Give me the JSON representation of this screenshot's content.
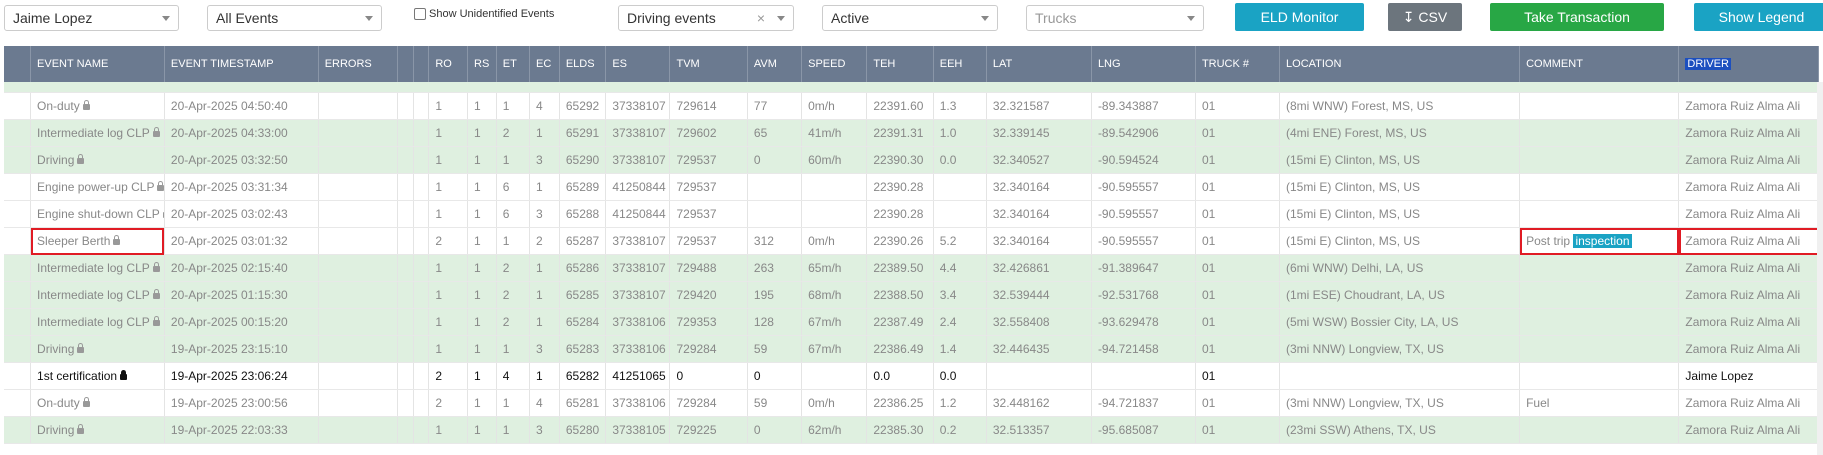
{
  "toolbar": {
    "driver": "Jaime Lopez",
    "events_filter": "All Events",
    "show_unidentified": "Show Unidentified Events",
    "event_type": "Driving events",
    "clear_glyph": "×",
    "status": "Active",
    "trucks_placeholder": "Trucks",
    "eld_monitor": "ELD Monitor",
    "csv": "CSV",
    "take_transaction": "Take Transaction",
    "show_legend": "Show Legend"
  },
  "columns": [
    "",
    "EVENT NAME",
    "EVENT TIMESTAMP",
    "ERRORS",
    "",
    "",
    "RO",
    "RS",
    "ET",
    "EC",
    "ELDS",
    "ES",
    "TVM",
    "AVM",
    "SPEED",
    "TEH",
    "EEH",
    "LAT",
    "LNG",
    "TRUCK #",
    "LOCATION",
    "COMMENT",
    "DRIVER"
  ],
  "rows": [
    {
      "style": "w",
      "name": "On-duty",
      "ts": "20-Apr-2025 04:50:40",
      "ro": "1",
      "rs": "1",
      "et": "1",
      "ec": "4",
      "elds": "65292",
      "es": "37338107",
      "tvm": "729614",
      "avm": "77",
      "speed": "0m/h",
      "teh": "22391.60",
      "eeh": "1.3",
      "lat": "32.321587",
      "lng": "-89.343887",
      "truck": "01",
      "loc": "(8mi WNW) Forest, MS, US",
      "comment": "",
      "driver": "Zamora Ruiz Alma Ali"
    },
    {
      "style": "g",
      "name": "Intermediate log CLP",
      "ts": "20-Apr-2025 04:33:00",
      "ro": "1",
      "rs": "1",
      "et": "2",
      "ec": "1",
      "elds": "65291",
      "es": "37338107",
      "tvm": "729602",
      "avm": "65",
      "speed": "41m/h",
      "teh": "22391.31",
      "eeh": "1.0",
      "lat": "32.339145",
      "lng": "-89.542906",
      "truck": "01",
      "loc": "(4mi ENE) Forest, MS, US",
      "comment": "",
      "driver": "Zamora Ruiz Alma Ali"
    },
    {
      "style": "g",
      "name": "Driving",
      "ts": "20-Apr-2025 03:32:50",
      "ro": "1",
      "rs": "1",
      "et": "1",
      "ec": "3",
      "elds": "65290",
      "es": "37338107",
      "tvm": "729537",
      "avm": "0",
      "speed": "60m/h",
      "teh": "22390.30",
      "eeh": "0.0",
      "lat": "32.340527",
      "lng": "-90.594524",
      "truck": "01",
      "loc": "(15mi E) Clinton, MS, US",
      "comment": "",
      "driver": "Zamora Ruiz Alma Ali"
    },
    {
      "style": "w",
      "name": "Engine power-up CLP",
      "ts": "20-Apr-2025 03:31:34",
      "ro": "1",
      "rs": "1",
      "et": "6",
      "ec": "1",
      "elds": "65289",
      "es": "41250844",
      "tvm": "729537",
      "avm": "",
      "speed": "",
      "teh": "22390.28",
      "eeh": "",
      "lat": "32.340164",
      "lng": "-90.595557",
      "truck": "01",
      "loc": "(15mi E) Clinton, MS, US",
      "comment": "",
      "driver": "Zamora Ruiz Alma Ali"
    },
    {
      "style": "w",
      "name": "Engine shut-down CLP",
      "ts": "20-Apr-2025 03:02:43",
      "ro": "1",
      "rs": "1",
      "et": "6",
      "ec": "3",
      "elds": "65288",
      "es": "41250844",
      "tvm": "729537",
      "avm": "",
      "speed": "",
      "teh": "22390.28",
      "eeh": "",
      "lat": "32.340164",
      "lng": "-90.595557",
      "truck": "01",
      "loc": "(15mi E) Clinton, MS, US",
      "comment": "",
      "driver": "Zamora Ruiz Alma Ali"
    },
    {
      "style": "w",
      "name": "Sleeper Berth",
      "ts": "20-Apr-2025 03:01:32",
      "ro": "2",
      "rs": "1",
      "et": "1",
      "ec": "2",
      "elds": "65287",
      "es": "37338107",
      "tvm": "729537",
      "avm": "312",
      "speed": "0m/h",
      "teh": "22390.26",
      "eeh": "5.2",
      "lat": "32.340164",
      "lng": "-90.595557",
      "truck": "01",
      "loc": "(15mi E) Clinton, MS, US",
      "comment": "Post trip",
      "comment_hl": "inspection",
      "driver": "Zamora Ruiz Alma Ali",
      "hl": true
    },
    {
      "style": "g",
      "name": "Intermediate log CLP",
      "ts": "20-Apr-2025 02:15:40",
      "ro": "1",
      "rs": "1",
      "et": "2",
      "ec": "1",
      "elds": "65286",
      "es": "37338107",
      "tvm": "729488",
      "avm": "263",
      "speed": "65m/h",
      "teh": "22389.50",
      "eeh": "4.4",
      "lat": "32.426861",
      "lng": "-91.389647",
      "truck": "01",
      "loc": "(6mi WNW) Delhi, LA, US",
      "comment": "",
      "driver": "Zamora Ruiz Alma Ali"
    },
    {
      "style": "g",
      "name": "Intermediate log CLP",
      "ts": "20-Apr-2025 01:15:30",
      "ro": "1",
      "rs": "1",
      "et": "2",
      "ec": "1",
      "elds": "65285",
      "es": "37338107",
      "tvm": "729420",
      "avm": "195",
      "speed": "68m/h",
      "teh": "22388.50",
      "eeh": "3.4",
      "lat": "32.539444",
      "lng": "-92.531768",
      "truck": "01",
      "loc": "(1mi ESE) Choudrant, LA, US",
      "comment": "",
      "driver": "Zamora Ruiz Alma Ali"
    },
    {
      "style": "g",
      "name": "Intermediate log CLP",
      "ts": "20-Apr-2025 00:15:20",
      "ro": "1",
      "rs": "1",
      "et": "2",
      "ec": "1",
      "elds": "65284",
      "es": "37338106",
      "tvm": "729353",
      "avm": "128",
      "speed": "67m/h",
      "teh": "22387.49",
      "eeh": "2.4",
      "lat": "32.558408",
      "lng": "-93.629478",
      "truck": "01",
      "loc": "(5mi WSW) Bossier City, LA, US",
      "comment": "",
      "driver": "Zamora Ruiz Alma Ali"
    },
    {
      "style": "g",
      "name": "Driving",
      "ts": "19-Apr-2025 23:15:10",
      "ro": "1",
      "rs": "1",
      "et": "1",
      "ec": "3",
      "elds": "65283",
      "es": "37338106",
      "tvm": "729284",
      "avm": "59",
      "speed": "67m/h",
      "teh": "22386.49",
      "eeh": "1.4",
      "lat": "32.446435",
      "lng": "-94.721458",
      "truck": "01",
      "loc": "(3mi NNW) Longview, TX, US",
      "comment": "",
      "driver": "Zamora Ruiz Alma Ali"
    },
    {
      "style": "w cert",
      "name": "1st certification",
      "ts": "19-Apr-2025 23:06:24",
      "ro": "2",
      "rs": "1",
      "et": "4",
      "ec": "1",
      "elds": "65282",
      "es": "41251065",
      "tvm": "0",
      "avm": "0",
      "speed": "",
      "teh": "0.0",
      "eeh": "0.0",
      "lat": "",
      "lng": "",
      "truck": "01",
      "loc": "",
      "comment": "",
      "driver": "Jaime Lopez"
    },
    {
      "style": "w",
      "name": "On-duty",
      "ts": "19-Apr-2025 23:00:56",
      "ro": "2",
      "rs": "1",
      "et": "1",
      "ec": "4",
      "elds": "65281",
      "es": "37338106",
      "tvm": "729284",
      "avm": "59",
      "speed": "0m/h",
      "teh": "22386.25",
      "eeh": "1.2",
      "lat": "32.448162",
      "lng": "-94.721837",
      "truck": "01",
      "loc": "(3mi NNW) Longview, TX, US",
      "comment": "Fuel",
      "driver": "Zamora Ruiz Alma Ali"
    },
    {
      "style": "g",
      "name": "Driving",
      "ts": "19-Apr-2025 22:03:33",
      "ro": "1",
      "rs": "1",
      "et": "1",
      "ec": "3",
      "elds": "65280",
      "es": "37338105",
      "tvm": "729225",
      "avm": "0",
      "speed": "62m/h",
      "teh": "22385.30",
      "eeh": "0.2",
      "lat": "32.513357",
      "lng": "-95.685087",
      "truck": "01",
      "loc": "(23mi SSW) Athens, TX, US",
      "comment": "",
      "driver": "Zamora Ruiz Alma Ali"
    }
  ]
}
